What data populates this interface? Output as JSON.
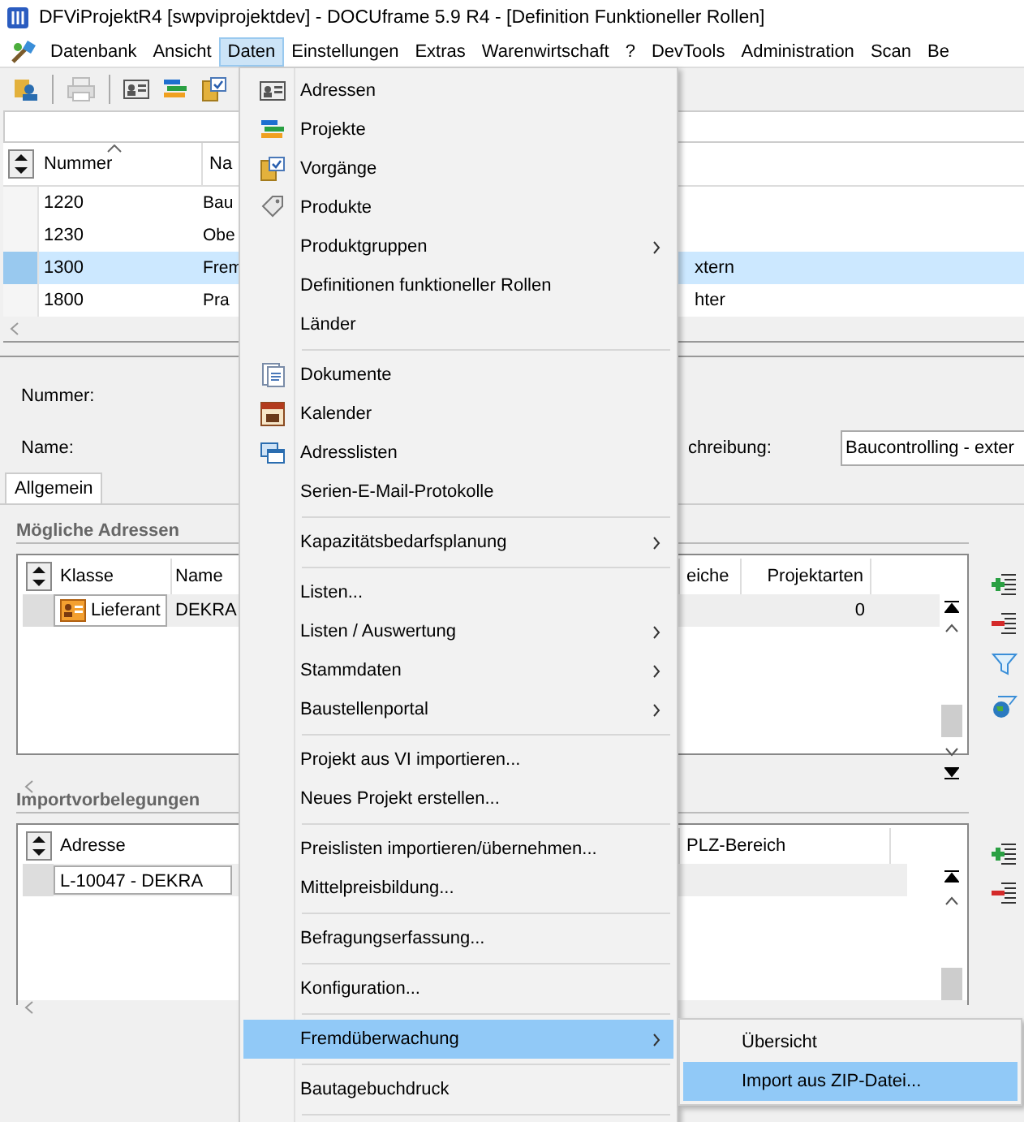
{
  "window": {
    "title": "DFViProjektR4 [swpviprojektdev] - DOCUframe 5.9 R4 - [Definition Funktioneller Rollen]"
  },
  "menu_bar": [
    {
      "label": "Datenbank",
      "selected": false
    },
    {
      "label": "Ansicht",
      "selected": false
    },
    {
      "label": "Daten",
      "selected": true
    },
    {
      "label": "Einstellungen",
      "selected": false
    },
    {
      "label": "Extras",
      "selected": false
    },
    {
      "label": "Warenwirtschaft",
      "selected": false
    },
    {
      "label": "?",
      "selected": false
    },
    {
      "label": "DevTools",
      "selected": false
    },
    {
      "label": "Administration",
      "selected": false
    },
    {
      "label": "Scan",
      "selected": false
    },
    {
      "label": "Be",
      "selected": false
    }
  ],
  "roles_table": {
    "columns": [
      "Nummer",
      "Na"
    ],
    "rows": [
      {
        "nummer": "1220",
        "name": "Bau",
        "selected": false
      },
      {
        "nummer": "1230",
        "name": "Obe",
        "selected": false
      },
      {
        "nummer": "1300",
        "name": "Frem",
        "column_3": "xtern",
        "selected": true
      },
      {
        "nummer": "1800",
        "name": "Pra",
        "column_3": "hter",
        "selected": false
      }
    ]
  },
  "details": {
    "fields": [
      {
        "label": "Nummer:"
      },
      {
        "label": "Name:"
      }
    ],
    "description": {
      "label": "chreibung:",
      "value": "Baucontrolling - exter"
    }
  },
  "tabs": [
    {
      "label": "Allgemein",
      "selected": true
    }
  ],
  "possible_addresses": {
    "title": "Mögliche Adressen",
    "columns": [
      "Klasse",
      "Name",
      "eiche",
      "Projektarten"
    ],
    "rows": [
      {
        "klasse": "Lieferant",
        "name": "DEKRA",
        "projektarten": "0"
      }
    ]
  },
  "import_defaults": {
    "title": "Importvorbelegungen",
    "columns": [
      "Adresse",
      "PLZ-Bereich"
    ],
    "rows": [
      {
        "adresse": "L-10047 - DEKRA"
      }
    ]
  },
  "menu": {
    "items": [
      {
        "kind": "item",
        "label": "Adressen",
        "selected": false
      },
      {
        "kind": "item",
        "label": "Projekte",
        "selected": false
      },
      {
        "kind": "item",
        "label": "Vorgänge",
        "selected": false
      },
      {
        "kind": "item",
        "label": "Produkte",
        "selected": false
      },
      {
        "kind": "submenu",
        "label": "Produktgruppen",
        "selected": false
      },
      {
        "kind": "item",
        "label": "Definitionen funktioneller Rollen",
        "selected": false
      },
      {
        "kind": "item",
        "label": "Länder",
        "selected": false
      },
      {
        "kind": "separator"
      },
      {
        "kind": "item",
        "label": "Dokumente",
        "selected": false
      },
      {
        "kind": "item",
        "label": "Kalender",
        "selected": false
      },
      {
        "kind": "item",
        "label": "Adresslisten",
        "selected": false
      },
      {
        "kind": "item",
        "label": "Serien-E-Mail-Protokolle",
        "selected": false
      },
      {
        "kind": "separator"
      },
      {
        "kind": "submenu",
        "label": "Kapazitätsbedarfsplanung",
        "selected": false
      },
      {
        "kind": "separator"
      },
      {
        "kind": "item",
        "label": "Listen...",
        "selected": false
      },
      {
        "kind": "submenu",
        "label": "Listen / Auswertung",
        "selected": false
      },
      {
        "kind": "submenu",
        "label": "Stammdaten",
        "selected": false
      },
      {
        "kind": "submenu",
        "label": "Baustellenportal",
        "selected": false
      },
      {
        "kind": "separator"
      },
      {
        "kind": "item",
        "label": "Projekt aus VI importieren...",
        "selected": false
      },
      {
        "kind": "item",
        "label": "Neues Projekt erstellen...",
        "selected": false
      },
      {
        "kind": "separator"
      },
      {
        "kind": "item",
        "label": "Preislisten importieren/übernehmen...",
        "selected": false
      },
      {
        "kind": "item",
        "label": "Mittelpreisbildung...",
        "selected": false
      },
      {
        "kind": "separator"
      },
      {
        "kind": "item",
        "label": "Befragungserfassung...",
        "selected": false
      },
      {
        "kind": "separator"
      },
      {
        "kind": "item",
        "label": "Konfiguration...",
        "selected": false
      },
      {
        "kind": "separator"
      },
      {
        "kind": "submenu",
        "label": "Fremdüberwachung",
        "selected": true
      },
      {
        "kind": "separator"
      },
      {
        "kind": "item",
        "label": "Bautagebuchdruck",
        "selected": false
      },
      {
        "kind": "separator"
      }
    ]
  },
  "submenu": {
    "items": [
      {
        "label": "Übersicht",
        "selected": false
      },
      {
        "label": "Import aus ZIP-Datei...",
        "selected": true
      }
    ]
  }
}
